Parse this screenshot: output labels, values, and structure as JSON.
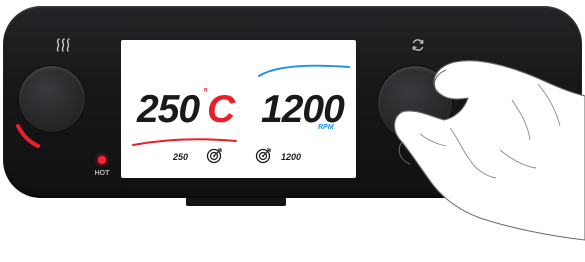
{
  "colors": {
    "device_body": "#1b1b1e",
    "temp_accent": "#e8202a",
    "speed_accent": "#1e90e6",
    "screen_bg": "#ffffff",
    "text_dark": "#1a1a1a"
  },
  "left_control": {
    "icon": "heat-waves-icon",
    "indicator_label": "HOT"
  },
  "right_control": {
    "icon": "rotation-icon"
  },
  "display": {
    "temperature": {
      "value": "250",
      "degree_symbol": "°",
      "unit": "C",
      "setpoint": "250",
      "setpoint_icon": "target-icon"
    },
    "speed": {
      "value": "1200",
      "unit": "RPM",
      "setpoint": "1200",
      "setpoint_icon": "target-icon"
    }
  }
}
